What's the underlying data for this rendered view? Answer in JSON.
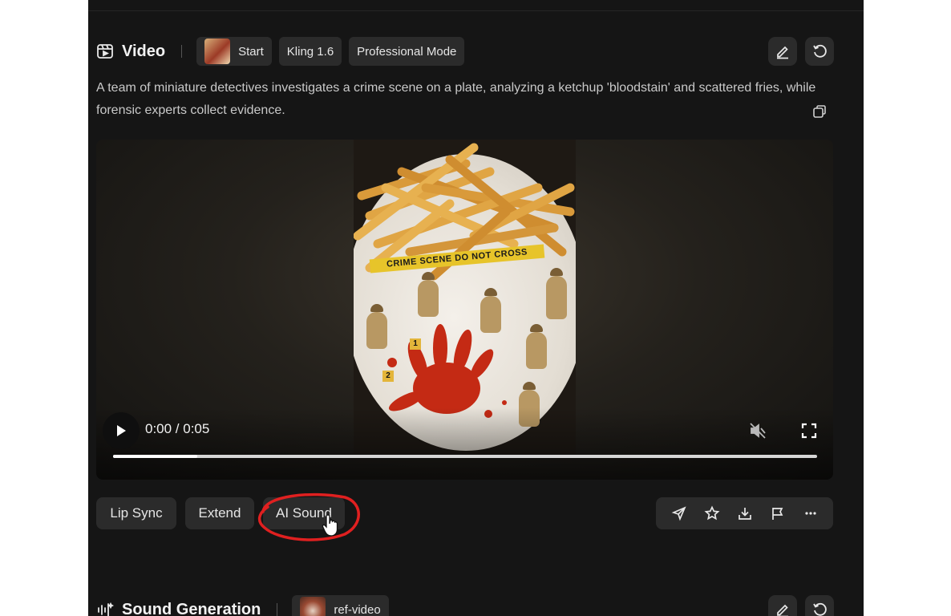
{
  "card": {
    "title": "Video",
    "chips": [
      "Start",
      "Kling 1.6",
      "Professional Mode"
    ],
    "prompt": "A team of miniature detectives investigates a crime scene on a plate, analyzing a ketchup 'bloodstain' and scattered fries, while forensic experts collect evidence."
  },
  "video": {
    "scene_text": "CRIME SCENE DO NOT CROSS",
    "markers": [
      "1",
      "2"
    ],
    "time": "0:00 / 0:05",
    "progress": 0.12
  },
  "actions": {
    "buttons": [
      "Lip Sync",
      "Extend",
      "AI Sound"
    ],
    "icons": [
      "send-icon",
      "star-icon",
      "download-icon",
      "flag-icon",
      "more-icon"
    ]
  },
  "next_card": {
    "title": "Sound Generation",
    "chip": "ref-video"
  },
  "colors": {
    "background": "#151515",
    "chip": "#2b2b2b",
    "annotation": "#e02020"
  }
}
